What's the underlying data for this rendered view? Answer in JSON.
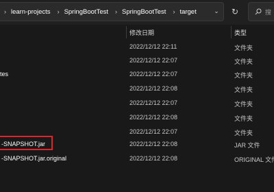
{
  "address_bar": {
    "breadcrumbs": [
      "learn-projects",
      "SpringBootTest",
      "SpringBootTest",
      "target"
    ],
    "separator": "›",
    "dropdown_glyph": "⌄",
    "refresh_glyph": "↻",
    "search_prefix": "搜"
  },
  "columns": {
    "date": "修改日期",
    "type": "类型"
  },
  "rows": [
    {
      "name": "",
      "date": "2022/12/12 22:11",
      "type": "文件夹"
    },
    {
      "name": "",
      "date": "2022/12/12 22:07",
      "type": "文件夹"
    },
    {
      "name": "tes",
      "date": "2022/12/12 22:07",
      "type": "文件夹"
    },
    {
      "name": "",
      "date": "2022/12/12 22:08",
      "type": "文件夹"
    },
    {
      "name": "",
      "date": "2022/12/12 22:07",
      "type": "文件夹"
    },
    {
      "name": "",
      "date": "2022/12/12 22:08",
      "type": "文件夹"
    },
    {
      "name": "",
      "date": "2022/12/12 22:07",
      "type": "文件夹"
    },
    {
      "name": "-SNAPSHOT.jar",
      "date": "2022/12/12 22:08",
      "type": "JAR 文件"
    },
    {
      "name": "-SNAPSHOT.jar.original",
      "date": "2022/12/12 22:08",
      "type": "ORIGINAL 文件"
    }
  ],
  "colors": {
    "background": "#191919",
    "highlight_border": "#e0242b"
  }
}
